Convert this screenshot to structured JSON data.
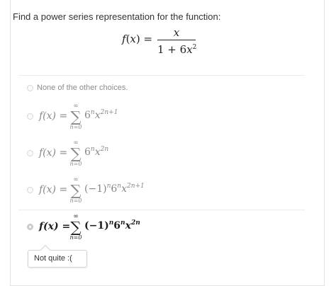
{
  "question": {
    "prompt": "Find a power series representation for the function:",
    "function": {
      "lhs_name": "f",
      "lhs_paren_open": "(",
      "lhs_var": "x",
      "lhs_paren_close": ")",
      "equals": "=",
      "numerator": "x",
      "denominator_const": "1 + 6",
      "denominator_var": "x",
      "denominator_exp": "2"
    }
  },
  "options": [
    {
      "label": "None of the other choices.",
      "selected": false
    },
    {
      "lhs": "f(x) =",
      "sum_top": "∞",
      "sum_symbol": "∑",
      "sum_bottom": "n=0",
      "base": "6",
      "base_exp": "n",
      "var": "x",
      "var_exp": "2n+1",
      "sign_factor": "",
      "sign_exp": "",
      "selected": false
    },
    {
      "lhs": "f(x) =",
      "sum_top": "∞",
      "sum_symbol": "∑",
      "sum_bottom": "n=0",
      "base": "6",
      "base_exp": "n",
      "var": "x",
      "var_exp": "2n",
      "sign_factor": "",
      "sign_exp": "",
      "selected": false
    },
    {
      "lhs": "f(x) =",
      "sum_top": "∞",
      "sum_symbol": "∑",
      "sum_bottom": "n=0",
      "sign_factor": "(−1)",
      "sign_exp": "n",
      "base": "6",
      "base_exp": "n",
      "var": "x",
      "var_exp": "2n+1",
      "selected": false
    },
    {
      "lhs": "f(x) =",
      "sum_top": "∞",
      "sum_symbol": "∑",
      "sum_bottom": "n=0",
      "sign_factor": "(−1)",
      "sign_exp": "n",
      "base": "6",
      "base_exp": "n",
      "var": "x",
      "var_exp": "2n",
      "selected": true
    }
  ],
  "feedback": {
    "text": "Not quite :("
  }
}
